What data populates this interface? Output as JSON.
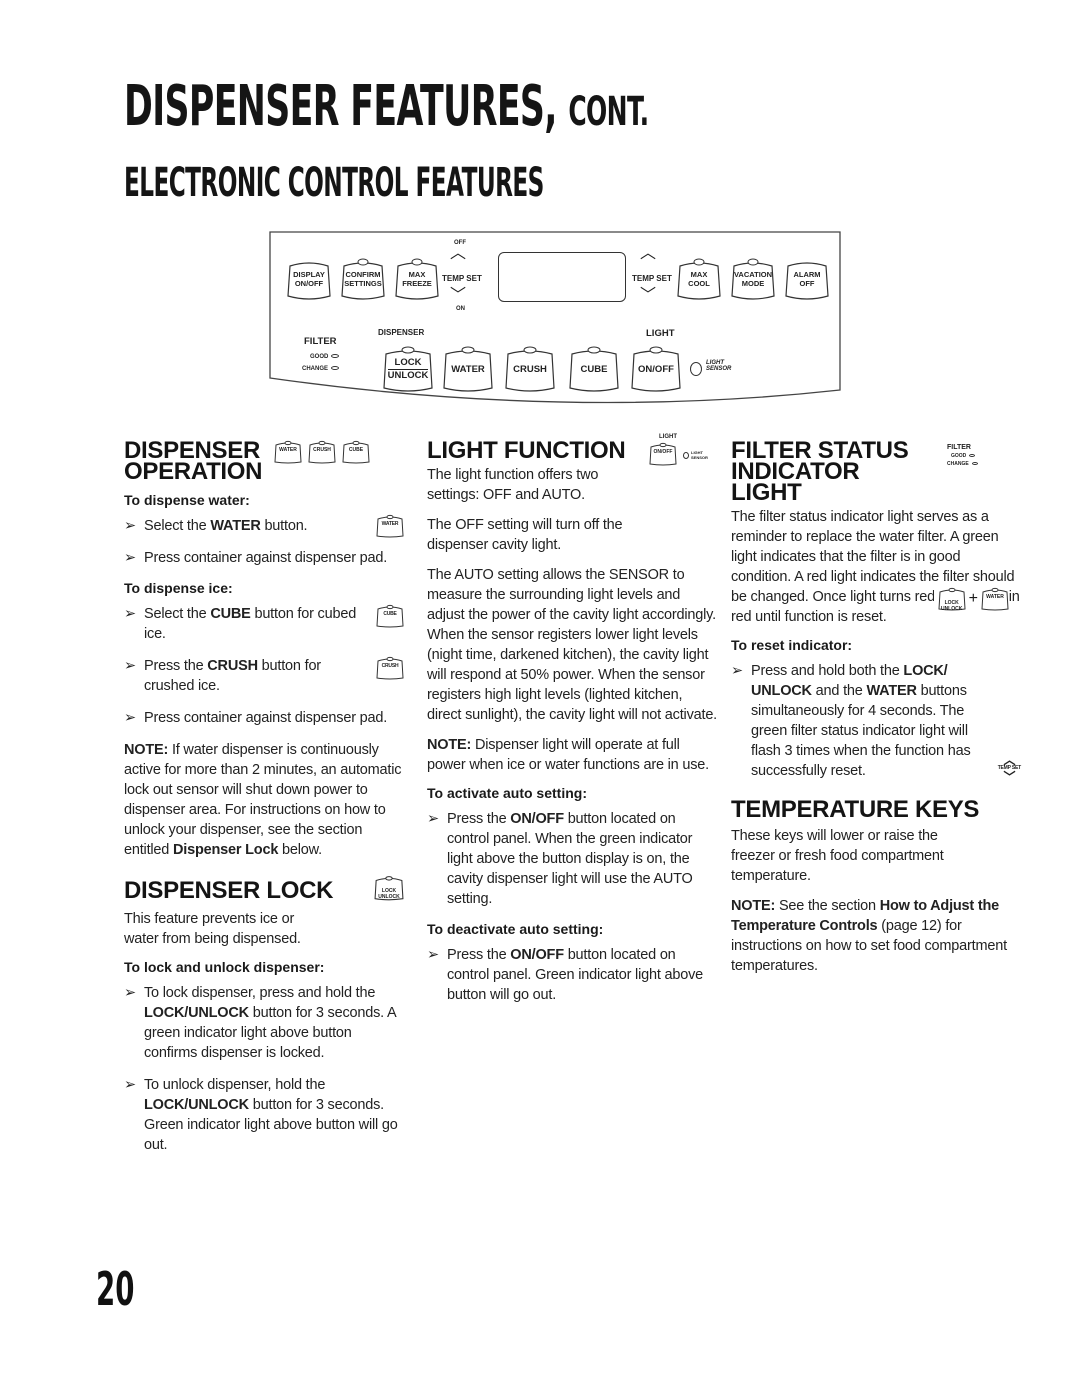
{
  "header": {
    "title_main": "DISPENSER FEATURES,",
    "title_cont": "CONT.",
    "subtitle": "ELECTRONIC CONTROL FEATURES"
  },
  "panel": {
    "top_buttons_left": [
      {
        "line1": "DISPLAY",
        "line2": "ON/OFF"
      },
      {
        "line1": "CONFIRM",
        "line2": "SETTINGS"
      },
      {
        "line1": "MAX",
        "line2": "FREEZE"
      }
    ],
    "temp_set_left": {
      "label": "TEMP SET",
      "up_label": "OFF",
      "down_label": "ON"
    },
    "temp_set_right": {
      "label": "TEMP SET"
    },
    "top_buttons_right": [
      {
        "line1": "MAX",
        "line2": "COOL"
      },
      {
        "line1": "VACATION",
        "line2": "MODE"
      },
      {
        "line1": "ALARM",
        "line2": "OFF"
      }
    ],
    "filter": {
      "label": "FILTER",
      "good": "GOOD",
      "change": "CHANGE"
    },
    "dispenser_label": "DISPENSER",
    "lock_button": {
      "line1": "LOCK",
      "line2": "UNLOCK"
    },
    "dispenser_buttons": [
      "WATER",
      "CRUSH",
      "CUBE"
    ],
    "light_label": "LIGHT",
    "light_button": "ON/OFF",
    "light_sensor": {
      "line1": "LIGHT",
      "line2": "SENSOR"
    }
  },
  "dispenser_operation": {
    "heading_line1": "DISPENSER",
    "heading_line2": "OPERATION",
    "icons": [
      "WATER",
      "CRUSH",
      "CUBE"
    ],
    "water": {
      "subheading": "To dispense water:",
      "steps": [
        {
          "pre": "Select the ",
          "bold": "WATER",
          "post": " button.",
          "icon": "WATER"
        },
        {
          "text": "Press container against dispenser pad."
        }
      ]
    },
    "ice": {
      "subheading": "To dispense ice:",
      "steps": [
        {
          "pre": "Select the ",
          "bold": "CUBE",
          "post": " button for cubed ice.",
          "icon": "CUBE"
        },
        {
          "pre": "Press the ",
          "bold": "CRUSH",
          "post": " button for crushed ice.",
          "icon": "CRUSH"
        },
        {
          "text": "Press container against dispenser pad."
        }
      ]
    },
    "note_label": "NOTE:",
    "note_text": " If water dispenser is continuously active for more than 2 minutes, an automatic lock out sensor will shut down power to dispenser area. For instructions on how to unlock your dispenser, see the section entitled ",
    "note_bold": "Dispenser Lock",
    "note_end": " below."
  },
  "dispenser_lock": {
    "heading": "DISPENSER LOCK",
    "icon": {
      "line1": "LOCK",
      "line2": "UNLOCK"
    },
    "intro": "This feature prevents ice or water from being dispensed.",
    "subheading": "To lock and unlock dispenser:",
    "steps": [
      {
        "pre": "To lock dispenser, press and hold the ",
        "bold": "LOCK/UNLOCK",
        "post": " button for 3 seconds. A green indicator light above button confirms dispenser is locked."
      },
      {
        "pre": "To unlock dispenser, hold the ",
        "bold": "LOCK/UNLOCK",
        "post": " button for 3 seconds. Green indicator light above button will go out."
      }
    ]
  },
  "light_function": {
    "heading": "LIGHT FUNCTION",
    "icon": {
      "top": "LIGHT",
      "button": "ON/OFF",
      "sensor": "LIGHT SENSOR"
    },
    "p1": "The light function offers two settings: OFF and AUTO.",
    "p2": "The OFF setting will turn off the dispenser cavity light.",
    "p3": "The AUTO setting allows the SENSOR to measure the surrounding light levels and adjust the power of the cavity light accordingly. When the sensor registers lower light levels (night time, darkened kitchen), the cavity light will respond at 50% power. When the sensor registers high light levels (lighted kitchen, direct sunlight), the cavity light will not activate.",
    "note_label": "NOTE:",
    "note_text": " Dispenser light will operate at full power when ice or water functions are in use.",
    "activate": {
      "subheading": "To activate auto setting:",
      "pre": "Press the ",
      "bold": "ON/OFF",
      "post": " button located on control panel.  When the green indicator light above the button display is on, the cavity dispenser light will use the AUTO setting."
    },
    "deactivate": {
      "subheading": "To deactivate auto setting:",
      "pre": "Press the ",
      "bold": "ON/OFF",
      "post": " button located on control panel. Green indicator light above button will go out."
    }
  },
  "filter_status": {
    "heading_line1": "FILTER STATUS",
    "heading_line2": "INDICATOR",
    "heading_line3": "LIGHT",
    "icon": {
      "label": "FILTER",
      "good": "GOOD",
      "change": "CHANGE"
    },
    "p1": "The filter status indicator light serves as a reminder to replace the water filter. A green light indicates that the filter is in good condition. A red light indicates the filter should be changed. Once light turns red, it will remain red until function is reset.",
    "combo_icon": {
      "left_line1": "LOCK",
      "left_line2": "UNLOCK",
      "plus": "+",
      "right": "WATER"
    },
    "subheading": "To reset indicator:",
    "step": {
      "pre": "Press and hold both the ",
      "bold1": "LOCK/ UNLOCK",
      "mid": " and the ",
      "bold2": "WATER",
      "post": " buttons simultaneously for 4 seconds. The green filter status indicator light will flash 3 times when the function has successfully reset."
    },
    "temp_icon_label": "TEMP SET"
  },
  "temperature_keys": {
    "heading": "TEMPERATURE KEYS",
    "p1": "These keys will lower or raise the freezer or fresh food compartment temperature.",
    "note_label": "NOTE:",
    "note_pre": "  See the section ",
    "note_bold": "How to Adjust the Temperature Controls",
    "note_post": " (page 12) for instructions on how to set food compartment temperatures."
  },
  "bullet": "➢",
  "page_number": "20"
}
